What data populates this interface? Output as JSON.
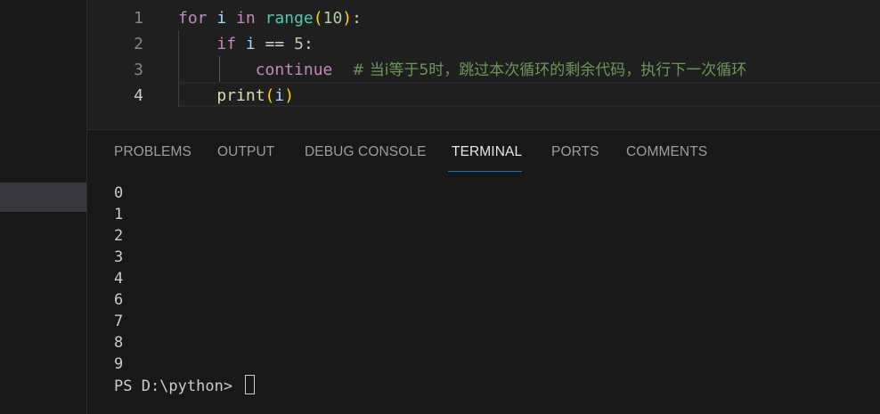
{
  "editor": {
    "line_numbers": [
      "1",
      "2",
      "3",
      "4"
    ],
    "active_line": "4",
    "lines": [
      {
        "tokens": [
          [
            "kw-ctrl",
            "for"
          ],
          [
            "op",
            " "
          ],
          [
            "var",
            "i"
          ],
          [
            "op",
            " "
          ],
          [
            "kw-ctrl",
            "in"
          ],
          [
            "op",
            " "
          ],
          [
            "builtin",
            "range"
          ],
          [
            "paren-y",
            "("
          ],
          [
            "num",
            "10"
          ],
          [
            "paren-y",
            ")"
          ],
          [
            "op",
            ":"
          ]
        ]
      },
      {
        "tokens": [
          [
            "op",
            "    "
          ],
          [
            "kw-ctrl",
            "if"
          ],
          [
            "op",
            " "
          ],
          [
            "var",
            "i"
          ],
          [
            "op",
            " == "
          ],
          [
            "num",
            "5"
          ],
          [
            "op",
            ":"
          ]
        ]
      },
      {
        "tokens": [
          [
            "op",
            "        "
          ],
          [
            "kw-ctrl",
            "continue"
          ],
          [
            "op",
            "  "
          ],
          [
            "comment",
            "# 当i等于5时，跳过本次循环的剩余代码，执行下一次循环"
          ]
        ]
      },
      {
        "tokens": [
          [
            "op",
            "    "
          ],
          [
            "fn",
            "print"
          ],
          [
            "paren-y",
            "("
          ],
          [
            "var",
            "i"
          ],
          [
            "paren-y",
            ")"
          ]
        ]
      }
    ]
  },
  "panel": {
    "tabs": [
      {
        "label": "PROBLEMS",
        "active": false
      },
      {
        "label": "OUTPUT",
        "active": false
      },
      {
        "label": "DEBUG CONSOLE",
        "active": false
      },
      {
        "label": "TERMINAL",
        "active": true
      },
      {
        "label": "PORTS",
        "active": false
      },
      {
        "label": "COMMENTS",
        "active": false
      }
    ]
  },
  "terminal": {
    "output": [
      "0",
      "1",
      "2",
      "3",
      "4",
      "6",
      "7",
      "8",
      "9"
    ],
    "prompt": "PS D:\\python> "
  },
  "colors": {
    "accent": "#0078d4",
    "keyword": "#c586c0",
    "builtin": "#4ec9b0",
    "comment": "#6a9955"
  }
}
